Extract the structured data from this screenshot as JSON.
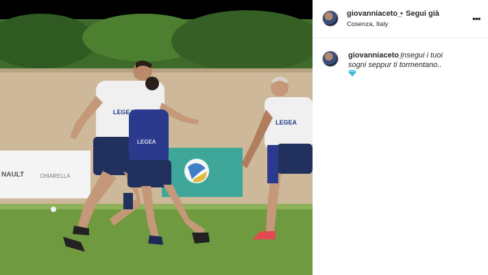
{
  "post": {
    "image_alt_icon": "football-training-photo",
    "shirt_brand": "LEGEA",
    "banner_left": "NAULT",
    "banner_left_2": "CHIARELLA"
  },
  "header": {
    "username": "giovanniaceto_",
    "separator": "•",
    "follow_label": "Segui già",
    "location": "Cosenza, Italy",
    "more_icon": "more-horizontal-icon"
  },
  "caption": {
    "username": "giovanniaceto_",
    "text_line1": "Insegui i tuoi",
    "text_line2": "sogni seppur ti tormentano..",
    "emoji_icon": "gem-emoji-icon"
  },
  "colors": {
    "accent_blue": "#2b3a8c",
    "grass": "#6f9a3f",
    "emoji_cyan": "#3fb8d6"
  }
}
